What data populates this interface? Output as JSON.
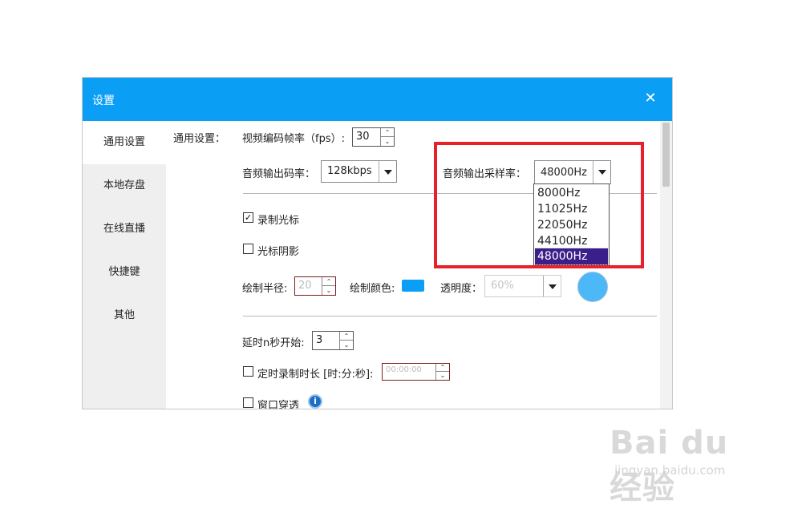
{
  "dialog": {
    "title": "设置",
    "accent": "#0a9ef5"
  },
  "sidebar": {
    "items": [
      {
        "label": "通用设置",
        "active": true
      },
      {
        "label": "本地存盘"
      },
      {
        "label": "在线直播"
      },
      {
        "label": "快捷键"
      },
      {
        "label": "其他"
      }
    ]
  },
  "general": {
    "section_label": "通用设置：",
    "fps_label": "视频编码帧率（fps）:",
    "fps_value": "30",
    "audio_bitrate_label": "音频输出码率：",
    "audio_bitrate_value": "128kbps",
    "sample_rate_label": "音频输出采样率：",
    "sample_rate_value": "48000Hz",
    "sample_rate_options": [
      "8000Hz",
      "11025Hz",
      "22050Hz",
      "44100Hz",
      "48000Hz"
    ],
    "sample_rate_selected": "48000Hz"
  },
  "cursor": {
    "record_cursor_label": "录制光标",
    "record_cursor_checked": true,
    "cursor_shadow_label": "光标阴影",
    "cursor_shadow_checked": false,
    "radius_label": "绘制半径:",
    "radius_value": "20",
    "color_label": "绘制颜色:",
    "color_value": "#0a9ef5",
    "opacity_label": "透明度：",
    "opacity_value": "60%",
    "preview_color": "#4db8f8"
  },
  "misc": {
    "delay_label": "延时n秒开始:",
    "delay_value": "3",
    "timed_label": "定时录制时长 [时:分:秒]:",
    "timed_value": "00:00:00",
    "window_label": "窗口穿透",
    "info_icon": "info-icon"
  },
  "watermark": {
    "logo": "Bai du 经验",
    "url": "jingyan.baidu.com"
  }
}
